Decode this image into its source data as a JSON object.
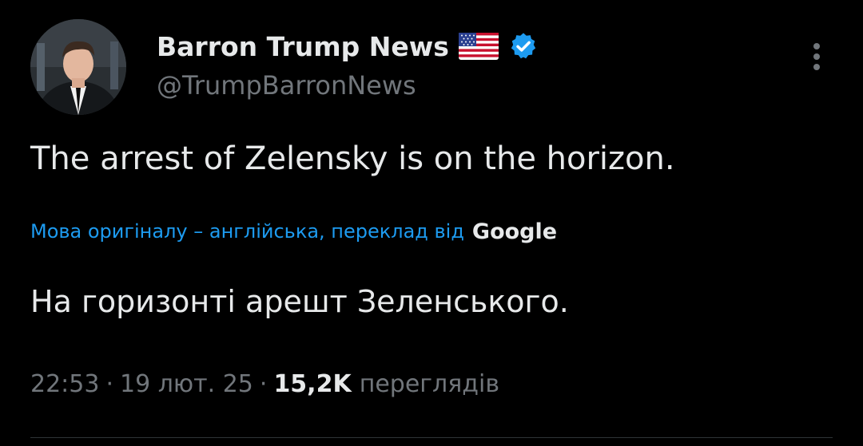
{
  "author": {
    "display_name": "Barron Trump News",
    "handle": "@TrumpBarronNews",
    "flag_icon": "us-flag-icon",
    "verified_icon": "verified-badge-icon",
    "verified_color": "#1d9bf0"
  },
  "tweet": {
    "text": "The arrest of Zelensky is on the horizon.",
    "translation_note": "Мова оригіналу – англійська, переклад від",
    "translation_provider": "Google",
    "translated_text": "На горизонті арешт Зеленського."
  },
  "meta": {
    "time": "22:53",
    "separator": "·",
    "date": "19 лют. 25",
    "views_count": "15,2K",
    "views_label": "переглядів"
  },
  "colors": {
    "background": "#000000",
    "primary_text": "#e7e9ea",
    "secondary_text": "#71767b",
    "link": "#1d9bf0"
  }
}
